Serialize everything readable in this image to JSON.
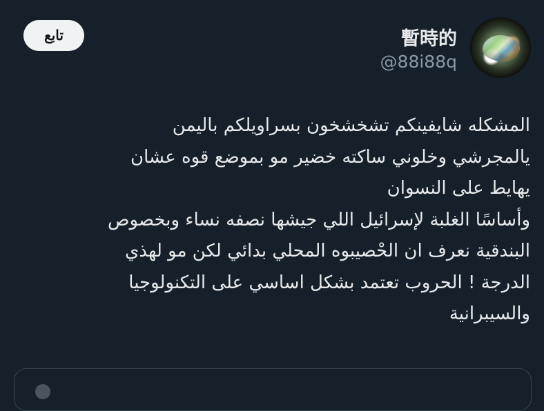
{
  "user": {
    "display_name": "暫時的",
    "handle": "@88i88q"
  },
  "follow_button": {
    "label": "تابع"
  },
  "tweet": {
    "lines": [
      "المشكله شايفينكم تشخشخون بسراويلكم باليمن",
      "يالمجرشي وخلوني ساكته خضير مو بموضع قوه عشان",
      "يهايط على النسوان",
      "وأساسًا الغلبة لإسرائيل اللي جيشها نصفه نساء وبخصوص",
      "البندقية نعرف ان الحْصيبوه المحلي بدائي لكن مو لهذي",
      "الدرجة ! الحروب تعتمد بشكل اساسي على التكنولوجيا",
      "والسيبرانية"
    ]
  },
  "colors": {
    "background": "#15202b",
    "text_primary": "#e7e9ea",
    "text_secondary": "#8b98a5",
    "button_bg": "#eff3f4",
    "border": "#38444d"
  }
}
